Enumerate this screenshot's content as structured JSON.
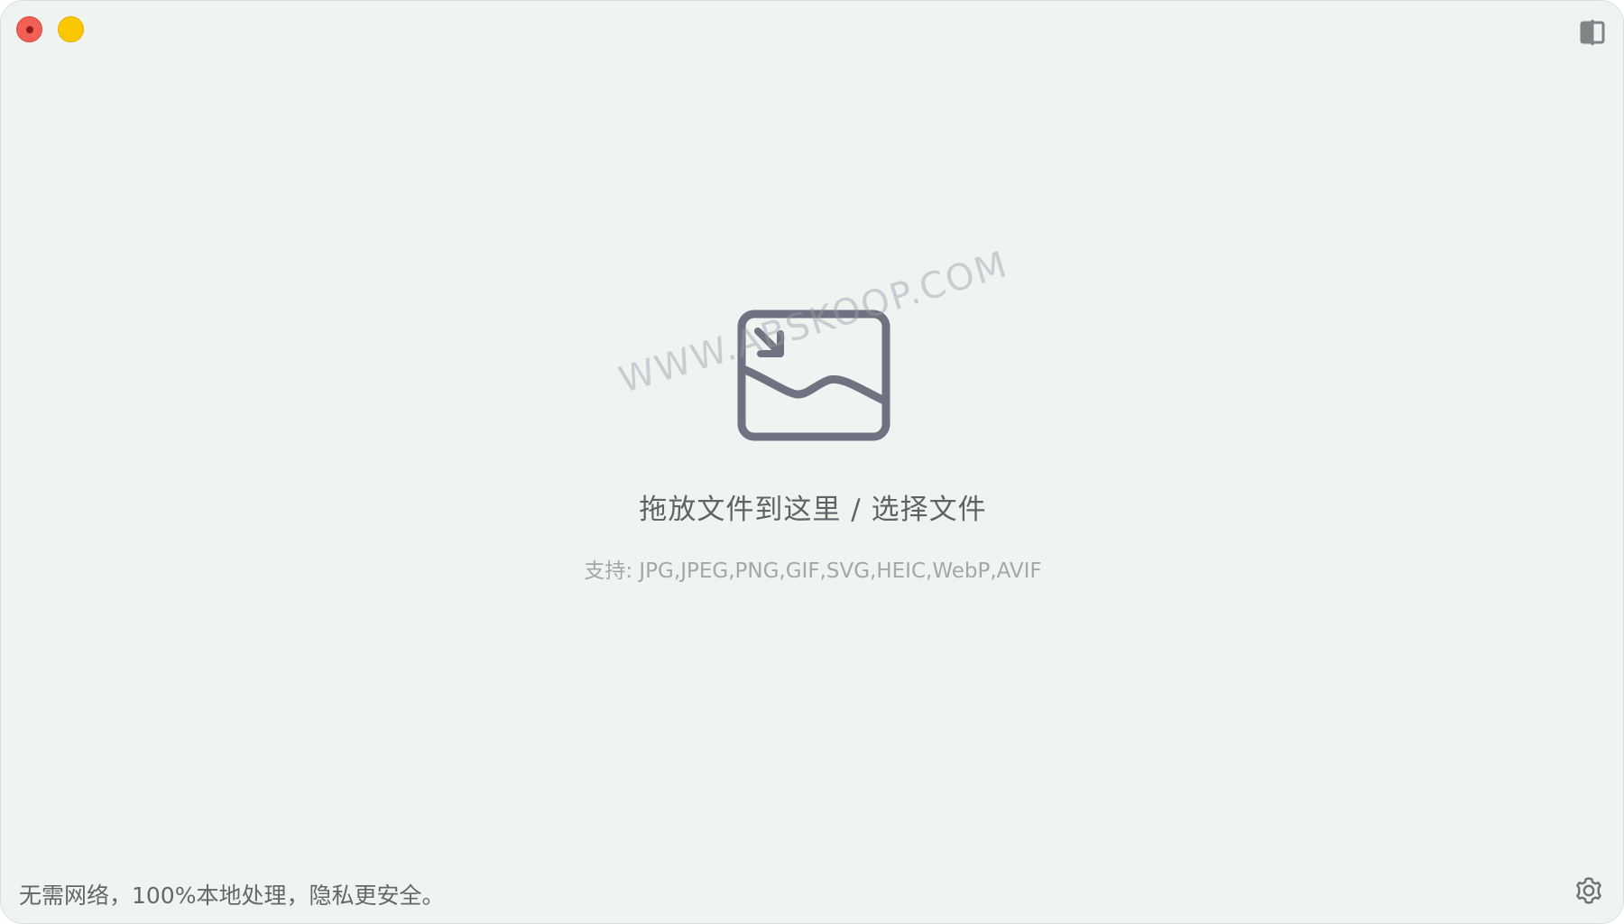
{
  "window": {
    "controls": {
      "close_icon": "close-dot-icon",
      "minimize_icon": "minimize-icon"
    },
    "sidebar_toggle_icon": "sidebar-toggle-icon"
  },
  "dropzone": {
    "icon": "image-import-icon",
    "title": "拖放文件到这里 / 选择文件",
    "formats": "支持: JPG,JPEG,PNG,GIF,SVG,HEIC,WebP,AVIF"
  },
  "watermark": "WWW.ABSKOOP.COM",
  "footer": {
    "note": "无需网络，100%本地处理，隐私更安全。",
    "settings_icon": "gear-icon"
  },
  "colors": {
    "background": "#eff4f3",
    "close": "#f25f57",
    "minimize": "#fdc700",
    "icon_stroke": "#6f7280",
    "text": "#5f6366",
    "muted_text": "#a3a7aa"
  }
}
